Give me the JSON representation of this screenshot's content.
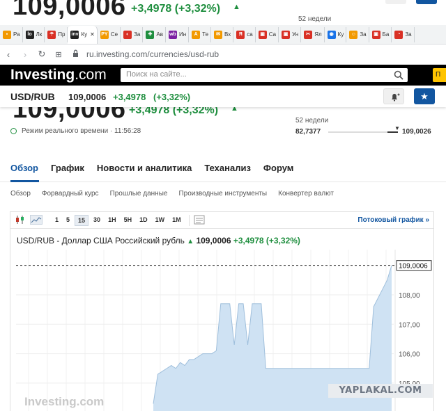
{
  "ghost_top": {
    "price": "109,0006",
    "change": "+3,4978 (+3,32%)",
    "week52_label": "52 недели"
  },
  "browser": {
    "tabs": [
      {
        "label": "Ра",
        "color": "#f29900",
        "glyph": "▪"
      },
      {
        "label": "Лк",
        "color": "#222222",
        "glyph": "lo"
      },
      {
        "label": "Пр",
        "color": "#d93025",
        "glyph": "☂"
      },
      {
        "label": "Ку",
        "color": "#222222",
        "glyph": "inv",
        "active": true
      },
      {
        "label": "Се",
        "color": "#f29900",
        "glyph": "PY"
      },
      {
        "label": "За",
        "color": "#d93025",
        "glyph": "◐"
      },
      {
        "label": "Ав",
        "color": "#1e8e3e",
        "glyph": "✚"
      },
      {
        "label": "Ин",
        "color": "#7b1fa2",
        "glyph": "wb"
      },
      {
        "label": "Те",
        "color": "#f29900",
        "glyph": "A"
      },
      {
        "label": "Вх",
        "color": "#f29900",
        "glyph": "✉"
      },
      {
        "label": "са",
        "color": "#d93025",
        "glyph": "Я"
      },
      {
        "label": "Са",
        "color": "#d93025",
        "glyph": "▣"
      },
      {
        "label": "Ун",
        "color": "#d93025",
        "glyph": "▣"
      },
      {
        "label": "Ял",
        "color": "#d93025",
        "glyph": "✂"
      },
      {
        "label": "Ку",
        "color": "#1a73e8",
        "glyph": "◉"
      },
      {
        "label": "За",
        "color": "#f29900",
        "glyph": "☺"
      },
      {
        "label": "Ба",
        "color": "#d93025",
        "glyph": "▣"
      },
      {
        "label": "За",
        "color": "#d93025",
        "glyph": "◔"
      }
    ],
    "close_glyph": "✕",
    "address": "ru.investing.com/currencies/usd-rub"
  },
  "header": {
    "logo_main": "Investing",
    "logo_suffix": ".com",
    "search_placeholder": "Поиск на сайте..."
  },
  "sticky": {
    "pair": "USD/RUB",
    "price": "109,0006",
    "change": "+3,4978",
    "change_pct": "(+3,32%)"
  },
  "quote": {
    "price": "109,0006",
    "change": "+3,4978 (+3,32%)",
    "realtime_label": "Режим реального времени · 11:56:28",
    "week52_label": "52 недели",
    "week52_low": "82,7377",
    "week52_high": "109,0026"
  },
  "nav": {
    "main_tabs": [
      "Обзор",
      "График",
      "Новости и аналитика",
      "Теханализ",
      "Форум"
    ],
    "sub_tabs": [
      "Обзор",
      "Форвардный курс",
      "Прошлые данные",
      "Производные инструменты",
      "Конвертер валют"
    ]
  },
  "chart_toolbar": {
    "timeframes": [
      "1",
      "5",
      "15",
      "30",
      "1H",
      "5H",
      "1D",
      "1W",
      "1M"
    ],
    "selected": "15",
    "stream_link": "Потоковый график »"
  },
  "chart_title": {
    "text": "USD/RUB - Доллар США Российский рубль",
    "price": "109,0006",
    "change": "+3,4978 (+3,32%)"
  },
  "chart_data": {
    "type": "area",
    "title": "USD/RUB - Доллар США Российский рубль",
    "yticks": [
      105,
      106,
      107,
      108
    ],
    "ytick_labels": [
      "105,00",
      "106,00",
      "107,00",
      "108,00"
    ],
    "ylim": [
      104.3,
      109.5
    ],
    "current_value": 109.0006,
    "current_label": "109,0006",
    "color": "#cfe2f3",
    "line_color": "#9fbfdc",
    "values": [
      104.3,
      105.3,
      105.4,
      105.5,
      105.6,
      105.5,
      105.7,
      105.6,
      105.8,
      105.8,
      105.9,
      106.0,
      106.0,
      106.0,
      106.1,
      107.7,
      107.7,
      107.7,
      106.3,
      107.7,
      107.7,
      106.3,
      107.7,
      107.7,
      107.7,
      105.5,
      105.5,
      105.5,
      105.5,
      105.5,
      105.5,
      105.5,
      105.5,
      105.5,
      105.5,
      105.5,
      105.5,
      105.5,
      105.5,
      105.5,
      105.5,
      105.5,
      105.5,
      105.5,
      105.5,
      105.5,
      105.5,
      105.5,
      105.5,
      107.6,
      107.9,
      108.2,
      108.5,
      109.0
    ]
  },
  "watermarks": {
    "investing": "Investing.com",
    "yaplakal": "YAPLAKAL.COM"
  }
}
